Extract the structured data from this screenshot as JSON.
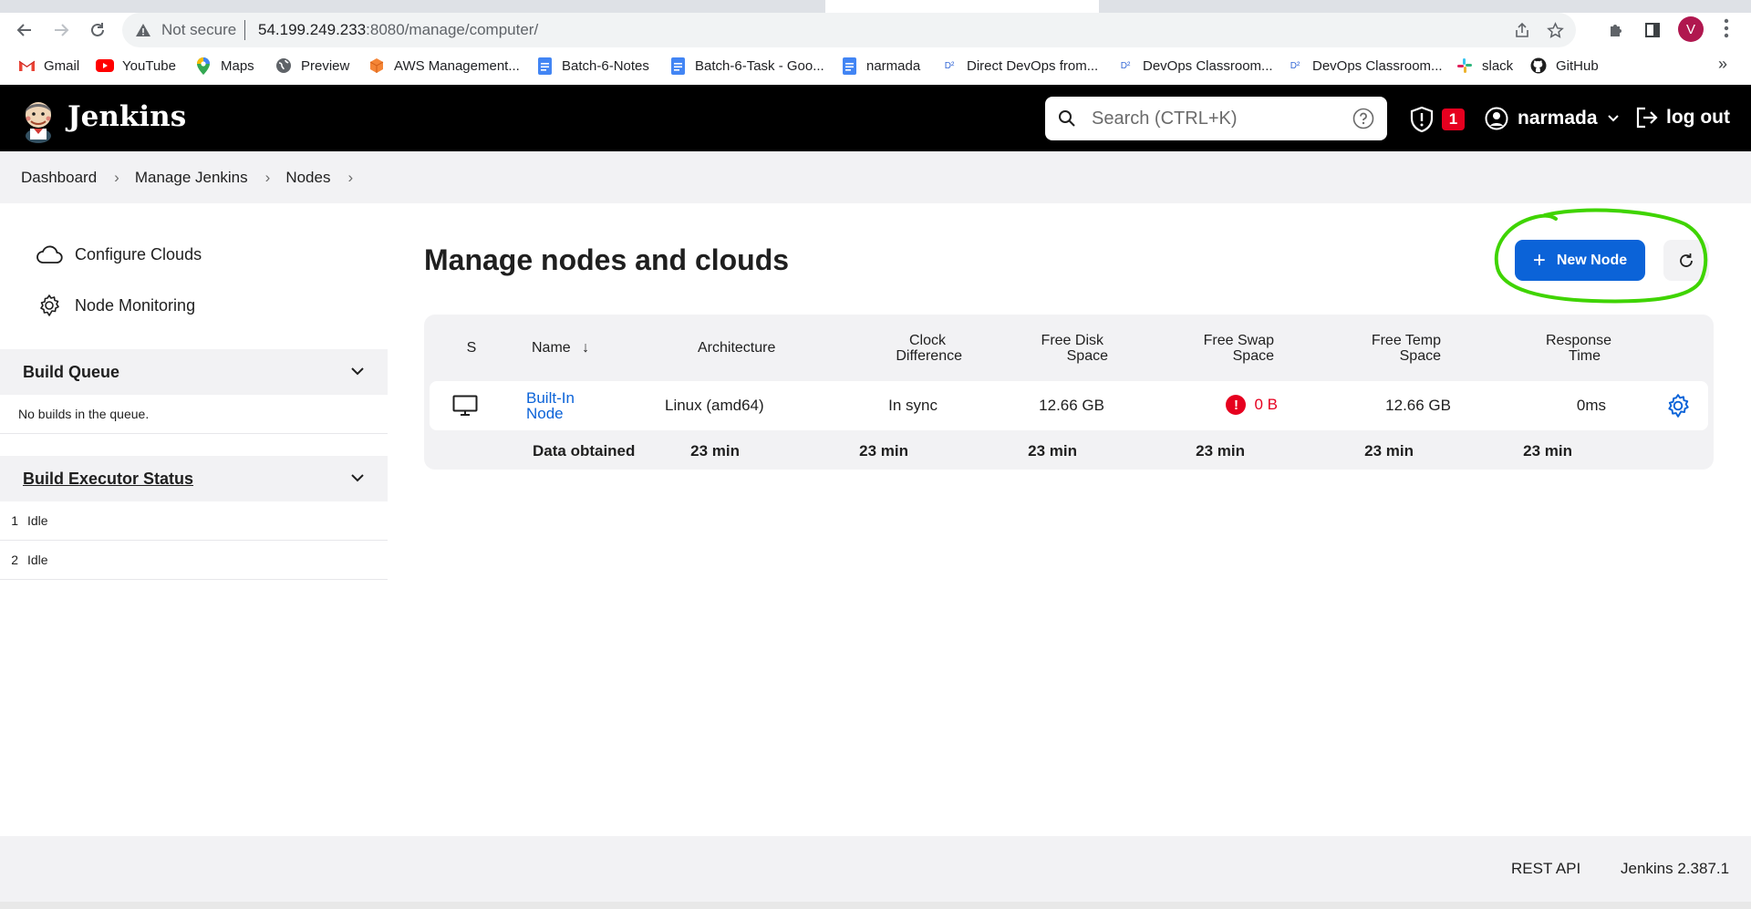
{
  "browser": {
    "security_label": "Not secure",
    "url_host": "54.199.249.233",
    "url_path": ":8080/manage/computer/",
    "profile_initial": "V",
    "bookmarks": [
      {
        "label": "Gmail",
        "icon": "gmail-icon"
      },
      {
        "label": "YouTube",
        "icon": "youtube-icon"
      },
      {
        "label": "Maps",
        "icon": "maps-icon"
      },
      {
        "label": "Preview",
        "icon": "globe-icon"
      },
      {
        "label": "AWS Management...",
        "icon": "aws-icon"
      },
      {
        "label": "Batch-6-Notes",
        "icon": "docs-icon"
      },
      {
        "label": "Batch-6-Task - Goo...",
        "icon": "docs-icon"
      },
      {
        "label": "narmada",
        "icon": "docs-icon"
      },
      {
        "label": "Direct DevOps from...",
        "icon": "devops-icon"
      },
      {
        "label": "DevOps Classroom...",
        "icon": "devops-icon"
      },
      {
        "label": "DevOps Classroom...",
        "icon": "devops-icon"
      },
      {
        "label": "slack",
        "icon": "slack-icon"
      },
      {
        "label": "GitHub",
        "icon": "github-icon"
      }
    ]
  },
  "header": {
    "brand": "Jenkins",
    "search_placeholder": "Search (CTRL+K)",
    "security_count": "1",
    "username": "narmada",
    "logout_label": "log out"
  },
  "breadcrumbs": [
    "Dashboard",
    "Manage Jenkins",
    "Nodes"
  ],
  "sidebar": {
    "tasks": [
      {
        "label": "Configure Clouds",
        "icon": "cloud-icon"
      },
      {
        "label": "Node Monitoring",
        "icon": "gear-icon"
      }
    ],
    "build_queue": {
      "title": "Build Queue",
      "empty_text": "No builds in the queue."
    },
    "executor_status": {
      "title": "Build Executor Status",
      "executors": [
        {
          "num": "1",
          "state": "Idle"
        },
        {
          "num": "2",
          "state": "Idle"
        }
      ]
    }
  },
  "main": {
    "title": "Manage nodes and clouds",
    "new_node_label": "New Node",
    "table": {
      "headers": {
        "status": "S",
        "name": "Name",
        "name_sort": "↓",
        "architecture": "Architecture",
        "clock_1": "Clock",
        "clock_2": "Difference",
        "disk_1": "Free Disk",
        "disk_2": "Space",
        "swap_1": "Free Swap",
        "swap_2": "Space",
        "temp_1": "Free Temp",
        "temp_2": "Space",
        "resp_1": "Response",
        "resp_2": "Time"
      },
      "row": {
        "name_line1": "Built-In",
        "name_line2": "Node",
        "architecture": "Linux (amd64)",
        "clock": "In sync",
        "free_disk": "12.66 GB",
        "free_swap": "0 B",
        "free_temp": "12.66 GB",
        "response": "0ms"
      },
      "footer": {
        "label": "Data obtained",
        "architecture": "23 min",
        "clock": "23 min",
        "disk": "23 min",
        "swap": "23 min",
        "temp": "23 min",
        "response": "23 min"
      }
    }
  },
  "footer": {
    "rest_api": "REST API",
    "version": "Jenkins 2.387.1"
  },
  "colors": {
    "jenkins_header": "#000000",
    "primary_button": "#0b63d8",
    "link": "#0b63d8",
    "error": "#e6001f",
    "highlight_annotation": "#3fd400"
  }
}
